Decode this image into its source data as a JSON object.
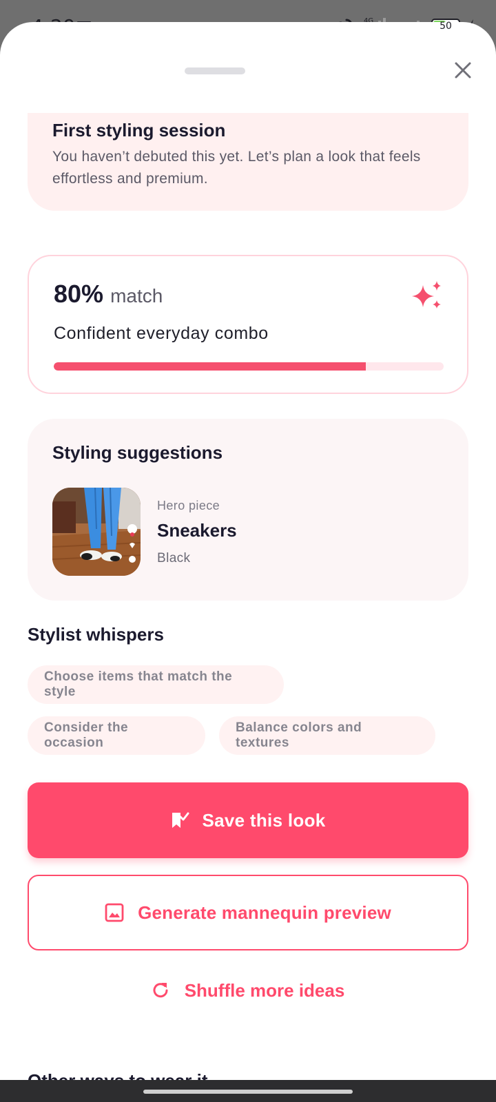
{
  "status_bar": {
    "time": "4:29",
    "network": "4G",
    "battery": "50"
  },
  "session_card": {
    "title": "First styling session",
    "text": "You haven’t debuted this yet. Let’s plan a look that feels effortless and premium."
  },
  "match_card": {
    "percent": "80%",
    "word": "match",
    "subtitle": "Confident everyday combo",
    "progress": 0.8
  },
  "suggestions": {
    "title": "Styling suggestions",
    "item": {
      "kicker": "Hero piece",
      "name": "Sneakers",
      "color": "Black"
    }
  },
  "whispers": {
    "title": "Stylist whispers",
    "chips": [
      "Choose items that match the style",
      "Consider the occasion",
      "Balance colors and textures"
    ]
  },
  "actions": {
    "save": "Save this look",
    "mannequin": "Generate mannequin preview",
    "shuffle": "Shuffle more ideas"
  },
  "other_section": {
    "title": "Other ways to wear it"
  },
  "colors": {
    "accent": "#ff4a6c",
    "soft_pink": "#fff0f0",
    "text_dark": "#1b1a2e"
  },
  "icons": [
    "message-icon",
    "more-icon",
    "link-icon",
    "signal-icon",
    "battery-icon",
    "charging-icon",
    "close-icon",
    "sparkle-icon",
    "bookmark-check-icon",
    "image-icon",
    "refresh-icon"
  ]
}
